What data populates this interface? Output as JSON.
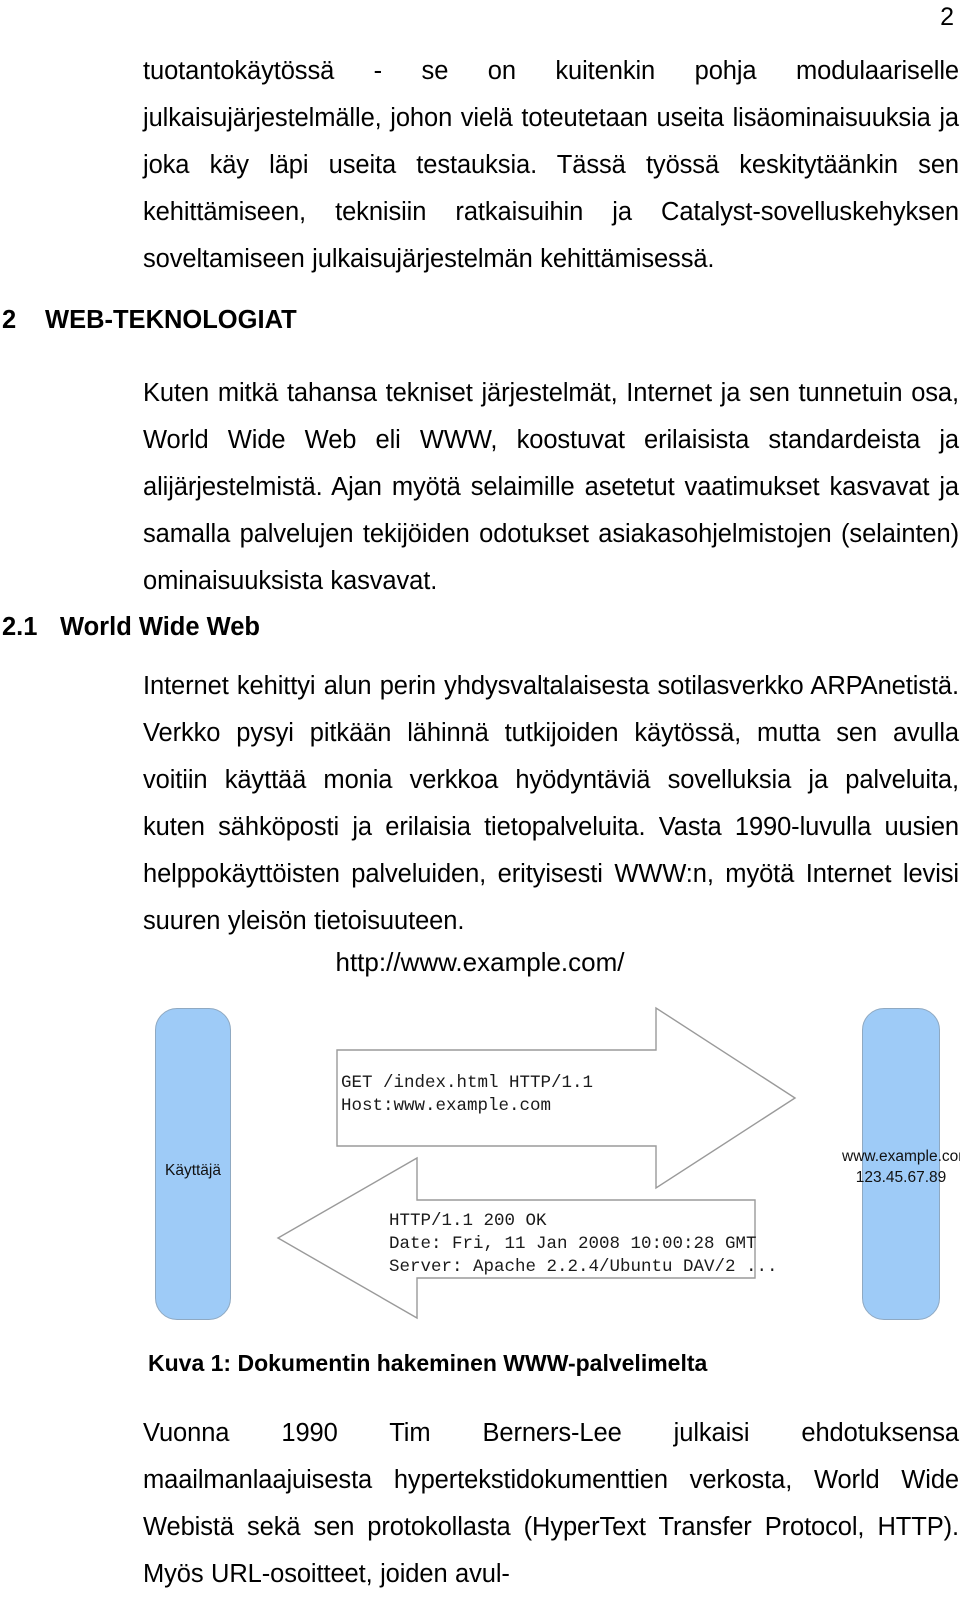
{
  "page": {
    "number": "2"
  },
  "paragraphs": {
    "intro": "tuotantokäytössä - se on kuitenkin pohja modulaariselle julkaisujärjestelmälle, johon vielä toteutetaan useita lisäominaisuuksia ja joka käy läpi useita testauksia. Tässä työssä keskitytäänkin sen kehittämiseen, teknisiin ratkaisuihin ja Catalyst-sovelluskehyksen soveltamiseen julkaisujärjestelmän kehittämisessä.",
    "web_tech": "Kuten mitkä tahansa tekniset järjestelmät, Internet ja sen tunnetuin osa, World Wide Web eli WWW, koostuvat erilaisista standardeista ja alijärjestelmistä. Ajan myötä selaimille asetetut vaatimukset kasvavat ja samalla palvelujen tekijöiden odotukset asiakasohjelmistojen (selainten) ominaisuuksista kasvavat.",
    "www": "Internet kehittyi alun perin yhdysvaltalaisesta sotilasverkko ARPAnetistä. Verkko pysyi pitkään lähinnä tutkijoiden käytössä, mutta sen avulla voitiin käyttää monia verkkoa hyödyntäviä sovelluksia ja palveluita, kuten sähköposti ja erilaisia tietopalveluita. Vasta 1990-luvulla uusien helppokäyttöisten palveluiden, erityisesti WWW:n, myötä Internet levisi suuren yleisön tietoisuuteen.",
    "berners_lee": "Vuonna 1990 Tim Berners-Lee julkaisi ehdotuksensa maailmanlaajuisesta hypertekstidokumenttien verkosta, World Wide Webistä sekä sen protokollasta (HyperText Transfer Protocol, HTTP). Myös URL-osoitteet, joiden avul-"
  },
  "headings": {
    "section2_number": "2",
    "section2_title": "WEB-TEKNOLOGIAT",
    "section21_number": "2.1",
    "section21_title": "World Wide Web"
  },
  "figure": {
    "url": "http://www.example.com/",
    "client_label": "Käyttäjä",
    "server_host": "www.example.com",
    "server_ip": "123.45.67.89",
    "request_text": "GET /index.html HTTP/1.1\nHost:www.example.com",
    "response_text": "HTTP/1.1 200 OK\nDate: Fri, 11 Jan 2008 10:00:28 GMT\nServer: Apache 2.2.4/Ubuntu DAV/2 ...",
    "caption": "Kuva 1: Dokumentin hakeminen WWW-palvelimelta",
    "node_fill_color": "#9ECBF7",
    "node_stroke_color": "#8FA9C2",
    "arrow_stroke_color": "#9a9a9a"
  }
}
